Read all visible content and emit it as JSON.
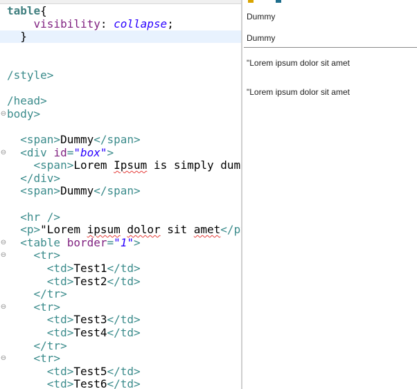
{
  "editor": {
    "lines": [
      {
        "fold": "",
        "parts": [
          [
            "kw",
            "table"
          ],
          [
            "tx",
            "{"
          ]
        ]
      },
      {
        "fold": "",
        "parts": [
          [
            "tx",
            "    "
          ],
          [
            "a",
            "visibility"
          ],
          [
            "tx",
            ": "
          ],
          [
            "v",
            "collapse"
          ],
          [
            "tx",
            ";"
          ]
        ]
      },
      {
        "fold": "",
        "parts": [
          [
            "tx",
            "  }"
          ]
        ]
      },
      {
        "fold": "",
        "parts": []
      },
      {
        "fold": "",
        "parts": []
      },
      {
        "fold": "",
        "parts": [
          [
            "t",
            "/style>"
          ]
        ]
      },
      {
        "fold": "",
        "parts": []
      },
      {
        "fold": "",
        "parts": [
          [
            "t",
            "/head>"
          ]
        ]
      },
      {
        "fold": "⊖",
        "parts": [
          [
            "t",
            "body>"
          ]
        ]
      },
      {
        "fold": "",
        "parts": []
      },
      {
        "fold": "",
        "parts": [
          [
            "tx",
            "  "
          ],
          [
            "t",
            "<span>"
          ],
          [
            "tx",
            "Dummy"
          ],
          [
            "t",
            "</span>"
          ]
        ]
      },
      {
        "fold": "⊖",
        "parts": [
          [
            "tx",
            "  "
          ],
          [
            "t",
            "<div "
          ],
          [
            "a",
            "id"
          ],
          [
            "t",
            "="
          ],
          [
            "v",
            "\"box\""
          ],
          [
            "t",
            ">"
          ]
        ]
      },
      {
        "fold": "",
        "parts": [
          [
            "tx",
            "    "
          ],
          [
            "t",
            "<span>"
          ],
          [
            "tx",
            "Lorem "
          ],
          [
            "sq",
            "Ipsum"
          ],
          [
            "tx",
            " is simply dummy t"
          ]
        ]
      },
      {
        "fold": "",
        "parts": [
          [
            "tx",
            "  "
          ],
          [
            "t",
            "</div>"
          ]
        ]
      },
      {
        "fold": "",
        "parts": [
          [
            "tx",
            "  "
          ],
          [
            "t",
            "<span>"
          ],
          [
            "tx",
            "Dummy"
          ],
          [
            "t",
            "</span>"
          ]
        ]
      },
      {
        "fold": "",
        "parts": []
      },
      {
        "fold": "",
        "parts": [
          [
            "tx",
            "  "
          ],
          [
            "t",
            "<hr />"
          ]
        ]
      },
      {
        "fold": "",
        "parts": [
          [
            "tx",
            "  "
          ],
          [
            "t",
            "<p>"
          ],
          [
            "tx",
            "\"Lorem "
          ],
          [
            "sq",
            "ipsum"
          ],
          [
            "tx",
            " "
          ],
          [
            "sq",
            "dolor"
          ],
          [
            "tx",
            " sit "
          ],
          [
            "sq",
            "amet"
          ],
          [
            "t",
            "</p>"
          ]
        ]
      },
      {
        "fold": "⊖",
        "parts": [
          [
            "tx",
            "  "
          ],
          [
            "t",
            "<table "
          ],
          [
            "a",
            "border"
          ],
          [
            "t",
            "="
          ],
          [
            "v",
            "\"1\""
          ],
          [
            "t",
            ">"
          ]
        ]
      },
      {
        "fold": "⊖",
        "parts": [
          [
            "tx",
            "    "
          ],
          [
            "t",
            "<tr>"
          ]
        ]
      },
      {
        "fold": "",
        "parts": [
          [
            "tx",
            "      "
          ],
          [
            "t",
            "<td>"
          ],
          [
            "tx",
            "Test1"
          ],
          [
            "t",
            "</td>"
          ]
        ]
      },
      {
        "fold": "",
        "parts": [
          [
            "tx",
            "      "
          ],
          [
            "t",
            "<td>"
          ],
          [
            "tx",
            "Test2"
          ],
          [
            "t",
            "</td>"
          ]
        ]
      },
      {
        "fold": "",
        "parts": [
          [
            "tx",
            "    "
          ],
          [
            "t",
            "</tr>"
          ]
        ]
      },
      {
        "fold": "⊖",
        "parts": [
          [
            "tx",
            "    "
          ],
          [
            "t",
            "<tr>"
          ]
        ]
      },
      {
        "fold": "",
        "parts": [
          [
            "tx",
            "      "
          ],
          [
            "t",
            "<td>"
          ],
          [
            "tx",
            "Test3"
          ],
          [
            "t",
            "</td>"
          ]
        ]
      },
      {
        "fold": "",
        "parts": [
          [
            "tx",
            "      "
          ],
          [
            "t",
            "<td>"
          ],
          [
            "tx",
            "Test4"
          ],
          [
            "t",
            "</td>"
          ]
        ]
      },
      {
        "fold": "",
        "parts": [
          [
            "tx",
            "    "
          ],
          [
            "t",
            "</tr>"
          ]
        ]
      },
      {
        "fold": "⊖",
        "parts": [
          [
            "tx",
            "    "
          ],
          [
            "t",
            "<tr>"
          ]
        ]
      },
      {
        "fold": "",
        "parts": [
          [
            "tx",
            "      "
          ],
          [
            "t",
            "<td>"
          ],
          [
            "tx",
            "Test5"
          ],
          [
            "t",
            "</td>"
          ]
        ]
      },
      {
        "fold": "",
        "parts": [
          [
            "tx",
            "      "
          ],
          [
            "t",
            "<td>"
          ],
          [
            "tx",
            "Test6"
          ],
          [
            "t",
            "</td>"
          ]
        ]
      }
    ]
  },
  "preview": {
    "line1": "Dummy",
    "line2": "Dummy",
    "para1": "\"Lorem ipsum dolor sit amet",
    "para2": "\"Lorem ipsum dolor sit amet"
  },
  "colors": {
    "tag": "#3a8b8b",
    "attribute": "#7f1f7f",
    "value": "#2a00ff",
    "current_line": "#e8f2fe"
  }
}
